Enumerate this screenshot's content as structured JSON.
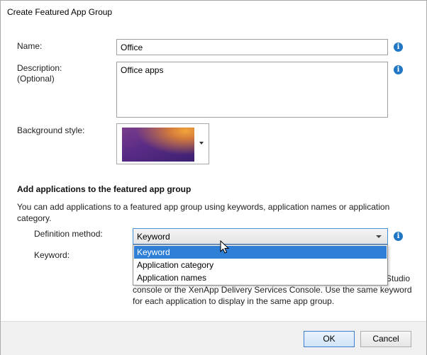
{
  "window": {
    "title": "Create Featured App Group"
  },
  "form": {
    "name_label": "Name:",
    "name_value": "Office",
    "description_label": "Description:",
    "description_optional": "(Optional)",
    "description_value": "Office apps",
    "background_label": "Background style:",
    "section_heading": "Add applications to the featured app group",
    "section_desc": "You can add applications to a featured app group using keywords, application names or application category.",
    "definition_label": "Definition method:",
    "definition_value": "Keyword",
    "definition_options": [
      "Keyword",
      "Application category",
      "Application names"
    ],
    "keyword_label": "Keyword:",
    "hint_line1": "Studio",
    "hint_line2": "console or the XenApp Delivery Services Console. Use the same keyword",
    "hint_line3": "for each application to display in the same app group."
  },
  "buttons": {
    "ok": "OK",
    "cancel": "Cancel"
  },
  "icons": {
    "info": "i"
  },
  "colors": {
    "accent": "#2f7fd6",
    "info": "#1f76c4"
  }
}
